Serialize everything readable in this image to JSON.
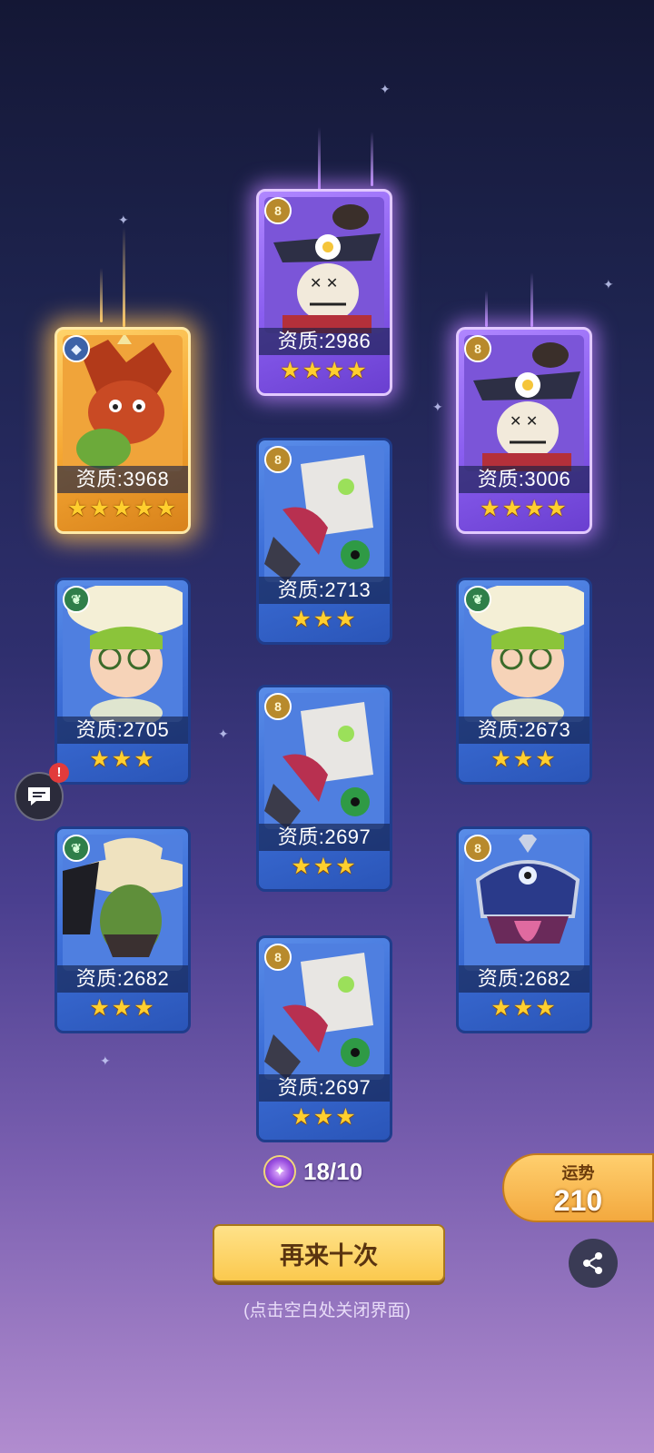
{
  "cards": [
    {
      "id": "c1",
      "rarity": "gold",
      "element": "dragon",
      "quality": "资质:3968",
      "stars": "★★★★★",
      "art": "dragon-hero"
    },
    {
      "id": "c2",
      "rarity": "purple",
      "element": "gold",
      "quality": "资质:2986",
      "stars": "★★★★",
      "art": "scarecrow-hero"
    },
    {
      "id": "c3",
      "rarity": "purple",
      "element": "gold",
      "quality": "资质:3006",
      "stars": "★★★★",
      "art": "scarecrow-hero"
    },
    {
      "id": "c4",
      "rarity": "blue",
      "element": "gold",
      "quality": "资质:2713",
      "stars": "★★★",
      "art": "robot-hero"
    },
    {
      "id": "c5",
      "rarity": "blue",
      "element": "green",
      "quality": "资质:2705",
      "stars": "★★★",
      "art": "mushroom-hero"
    },
    {
      "id": "c6",
      "rarity": "blue",
      "element": "green",
      "quality": "资质:2673",
      "stars": "★★★",
      "art": "mushroom-hero"
    },
    {
      "id": "c7",
      "rarity": "blue",
      "element": "gold",
      "quality": "资质:2697",
      "stars": "★★★",
      "art": "robot-hero"
    },
    {
      "id": "c8",
      "rarity": "blue",
      "element": "green",
      "quality": "资质:2682",
      "stars": "★★★",
      "art": "cactus-hero"
    },
    {
      "id": "c9",
      "rarity": "blue",
      "element": "gold",
      "quality": "资质:2682",
      "stars": "★★★",
      "art": "mimic-hero"
    },
    {
      "id": "c10",
      "rarity": "blue",
      "element": "gold",
      "quality": "资质:2697",
      "stars": "★★★",
      "art": "robot-hero"
    }
  ],
  "summon_count": "18/10",
  "again_button": "再来十次",
  "close_hint": "(点击空白处关闭界面)",
  "fortune": {
    "label": "运势",
    "value": "210"
  },
  "colors": {
    "gold_card": "#f5a733",
    "purple_card": "#8a5ef0",
    "blue_card": "#3d6fd8",
    "star": "#ffcf2e"
  }
}
